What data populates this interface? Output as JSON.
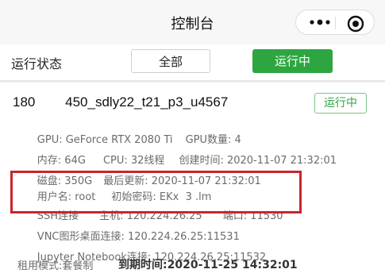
{
  "header": {
    "title": "控制台"
  },
  "filters": {
    "label": "运行状态",
    "all": "全部",
    "running": "运行中"
  },
  "instance": {
    "name": "180        450_sdly22_t21_p3_u4567",
    "status": "运行中",
    "gpu": "GPU: GeForce RTX 2080 Ti",
    "gpu_count": "GPU数量: 4",
    "memory": "内存: 64G",
    "cpu": "CPU: 32线程",
    "created": "创建时间: 2020-11-07 21:32:01",
    "disk": "磁盘: 350G",
    "updated": "最后更新: 2020-11-07 21:32:01",
    "username": "用户名: root",
    "password": "初始密码: EKx  3 .lm",
    "ssh": "SSH连接",
    "host": "主机: 120.224.26.25",
    "port": "端口: 11530",
    "vnc": "VNC图形桌面连接: 120.224.26.25:11531",
    "jupyter": "Jupyter Notebook连接: 120.224.26.25:11532",
    "rent_mode": "租用模式:套餐制",
    "expire": "到期时间:2020-11-25 14:32:01"
  },
  "colors": {
    "accent_green": "#2da641",
    "highlight_red": "#c9252c"
  },
  "icons": {
    "more": "more-dots-icon",
    "close": "target-circle-icon"
  }
}
